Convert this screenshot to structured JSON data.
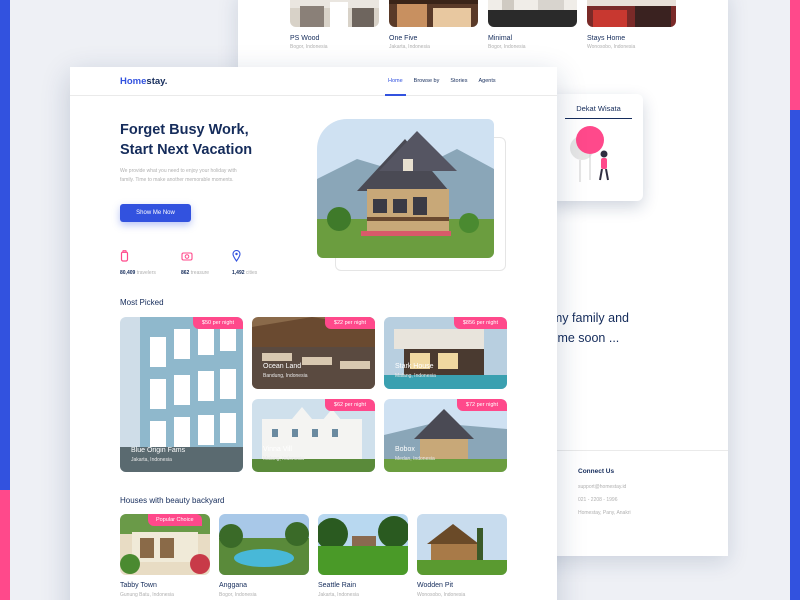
{
  "colors": {
    "primary": "#3252df",
    "accent": "#ff498b",
    "text_dark": "#152c5b",
    "text_muted": "#b0b0b0"
  },
  "background_page": {
    "stays": [
      {
        "name": "PS Wood",
        "location": "Bogor, Indonesia"
      },
      {
        "name": "One Five",
        "location": "Jakarta, Indonesia"
      },
      {
        "name": "Minimal",
        "location": "Bogor, Indonesia"
      },
      {
        "name": "Stays Home",
        "location": "Wonosobo, Indonesia"
      }
    ],
    "testimonial_line1": "th my family and",
    "testimonial_line2": "xt time soon ...",
    "connect_title": "Connect Us",
    "connect_email": "support@homestay.id",
    "connect_phone": "021 - 2208 - 1996",
    "connect_address": "Homestay, Pany, Anakri"
  },
  "floating_card": {
    "title": "Dekat Wisata"
  },
  "nav": {
    "logo_part1": "Home",
    "logo_part2": "stay.",
    "links": [
      "Home",
      "Browse by",
      "Stories",
      "Agents"
    ]
  },
  "hero": {
    "title_line1": "Forget Busy Work,",
    "title_line2": "Start Next Vacation",
    "description": "We provide what you need to enjoy your holiday with family. Time to make another memorable moments.",
    "cta_label": "Show Me Now",
    "stats": [
      {
        "value": "80,409",
        "label": "travelers",
        "icon": "traveler-icon"
      },
      {
        "value": "862",
        "label": "treasure",
        "icon": "camera-icon"
      },
      {
        "value": "1,492",
        "label": "cities",
        "icon": "location-pin-icon"
      }
    ]
  },
  "most_picked": {
    "title": "Most Picked",
    "items": [
      {
        "name": "Blue Origin Fams",
        "location": "Jakarta, Indonesia",
        "price": "$50 per night"
      },
      {
        "name": "Ocean Land",
        "location": "Bandung, Indonesia",
        "price": "$22 per night"
      },
      {
        "name": "Stark House",
        "location": "Malang, Indonesia",
        "price": "$856 per night"
      },
      {
        "name": "Vinna Vill",
        "location": "Malang, Indonesia",
        "price": "$62 per night"
      },
      {
        "name": "Bobox",
        "location": "Medan, Indonesia",
        "price": "$72 per night"
      }
    ]
  },
  "backyard": {
    "title": "Houses with beauty backyard",
    "popular_label": "Popular Choice",
    "items": [
      {
        "name": "Tabby Town",
        "location": "Gunung Batu, Indonesia"
      },
      {
        "name": "Anggana",
        "location": "Bogor, Indonesia"
      },
      {
        "name": "Seattle Rain",
        "location": "Jakarta, Indonesia"
      },
      {
        "name": "Wodden Pit",
        "location": "Wonosobo, Indonesia"
      }
    ]
  }
}
